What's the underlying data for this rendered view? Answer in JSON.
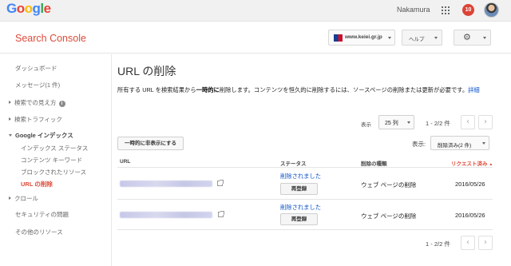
{
  "google_bar": {
    "logo_letters": [
      "G",
      "o",
      "o",
      "g",
      "l",
      "e"
    ],
    "user_name": "Nakamura",
    "notification_count": "10",
    "apps_icon": "apps-grid-icon",
    "avatar_icon": "user-avatar"
  },
  "header": {
    "product_title": "Search Console",
    "site_selector": "www.keiei.gr.jp",
    "help_label": "ヘルプ",
    "settings_icon": "gear-icon"
  },
  "sidebar": {
    "items": [
      {
        "label": "ダッシュボード"
      },
      {
        "label": "メッセージ(1 件)"
      },
      {
        "label": "検索での見え方"
      },
      {
        "label": "検索トラフィック"
      },
      {
        "label": "Google インデックス"
      },
      {
        "label": "インデックス ステータス"
      },
      {
        "label": "コンテンツ キーワード"
      },
      {
        "label": "ブロックされたリソース"
      },
      {
        "label": "URL の削除"
      },
      {
        "label": "クロール"
      },
      {
        "label": "セキュリティの問題"
      },
      {
        "label": "その他のリソース"
      }
    ]
  },
  "main": {
    "title": "URL の削除",
    "desc_part1": "所有する URL を検索結果から",
    "desc_bold": "一時的に",
    "desc_part2": "削除します。コンテンツを恒久的に削除するには、ソースページの削除または更新が必要です。",
    "desc_link": "詳細",
    "show_label": "表示",
    "rows_per_page": "25 列",
    "page_info_top": "1 - 2/2 件",
    "page_info_bottom": "1 - 2/2 件",
    "hide_button": "一時的に非表示にする",
    "filter_label": "表示:",
    "filter_value": "削除済み(2 件)",
    "columns": {
      "url": "URL",
      "status": "ステータス",
      "type": "削除の種類",
      "requested": "リクエスト済み"
    },
    "rows": [
      {
        "status": "削除されました",
        "action": "再登録",
        "type": "ウェブ ページの削除",
        "date": "2016/05/26"
      },
      {
        "status": "削除されました",
        "action": "再登録",
        "type": "ウェブ ページの削除",
        "date": "2016/05/26"
      }
    ]
  }
}
